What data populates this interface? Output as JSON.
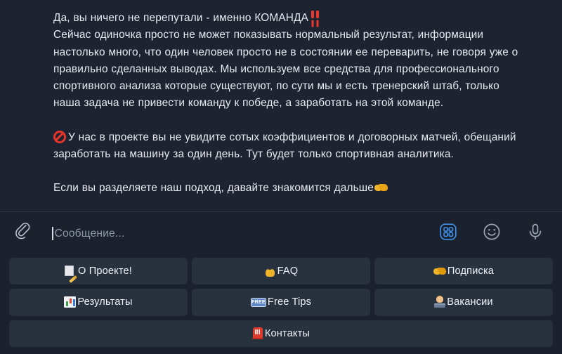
{
  "message": {
    "paragraphs": [
      {
        "id": "p1",
        "lines": [
          "Да, вы ничего не перепутали - именно КОМАНДА",
          "Сейчас одиночка просто не может показывать нормальный результат, информации настолько много, что один человек просто не в состоянии ее переварить, не говоря уже о правильно сделанных выводах. Мы используем все средства для профессионального спортивного анализа которые существуют, по сути мы и есть тренерский штаб, только наша задача не привести команду к победе, а заработать на этой команде."
        ],
        "trailing_emoji": "double-exclamation-mark-emoji"
      },
      {
        "id": "p2",
        "leading_emoji": "prohibited-sign-emoji",
        "text": "У нас в проекте вы не увидите сотых коэффициентов и договорных матчей, обещаний заработать на машину за один день. Тут будет только спортивная аналитика."
      },
      {
        "id": "p3",
        "text": "Если вы разделяете наш подход, давайте знакомится дальше",
        "trailing_emoji": "handshake-emoji"
      }
    ]
  },
  "composer": {
    "attach_icon": "paperclip-icon",
    "placeholder": "Сообщение...",
    "input_value": "",
    "icons": [
      {
        "name": "bot-commands-grid-icon",
        "active": true,
        "color": "#3f90e8"
      },
      {
        "name": "emoji-smiley-icon",
        "active": false,
        "color": "#9aa6b6"
      },
      {
        "name": "microphone-icon",
        "active": false,
        "color": "#9aa6b6"
      }
    ]
  },
  "keyboard": {
    "rows": [
      [
        {
          "emoji": "memo-emoji",
          "label": "О Проекте!"
        },
        {
          "emoji": "graduate-emoji",
          "label": "FAQ"
        },
        {
          "emoji": "handshake-emoji",
          "label": "Подписка"
        }
      ],
      [
        {
          "emoji": "bar-chart-emoji",
          "label": "Результаты"
        },
        {
          "emoji": "free-badge-emoji",
          "label": "Free Tips"
        },
        {
          "emoji": "technologist-emoji",
          "label": "Вакансии"
        }
      ],
      [
        {
          "emoji": "telephone-emoji",
          "label": "Контакты"
        }
      ]
    ]
  },
  "colors": {
    "message_background": "#1d2330",
    "composer_background": "#1b222e",
    "button_background": "#28323f",
    "text_primary": "#e6eaf0",
    "placeholder_text": "#8d99ab",
    "accent_blue": "#3f90e8",
    "divider": "#2c3748"
  }
}
